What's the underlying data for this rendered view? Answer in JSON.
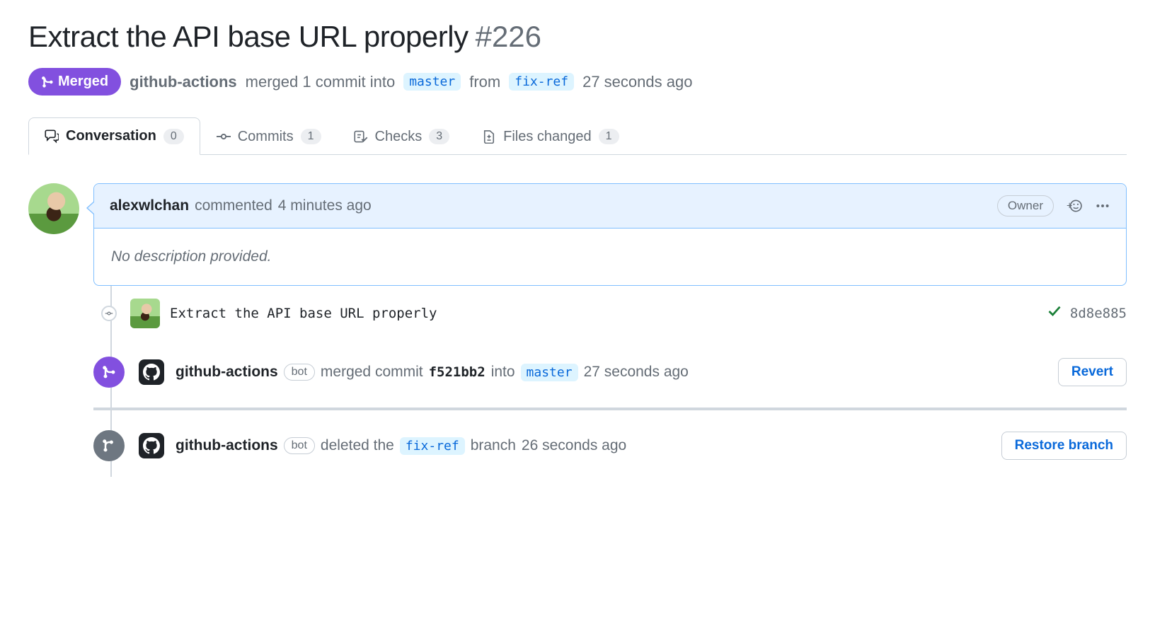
{
  "pr": {
    "title": "Extract the API base URL properly",
    "number": "#226",
    "state": "Merged",
    "meta_actor": "github-actions",
    "meta_text1": "merged 1 commit into",
    "base_branch": "master",
    "meta_text2": "from",
    "head_branch": "fix-ref",
    "meta_time": "27 seconds ago"
  },
  "tabs": {
    "conversation": {
      "label": "Conversation",
      "count": "0"
    },
    "commits": {
      "label": "Commits",
      "count": "1"
    },
    "checks": {
      "label": "Checks",
      "count": "3"
    },
    "files": {
      "label": "Files changed",
      "count": "1"
    }
  },
  "comment": {
    "author": "alexwlchan",
    "action": "commented",
    "time": "4 minutes ago",
    "role": "Owner",
    "body": "No description provided."
  },
  "commit_event": {
    "message": "Extract the API base URL properly",
    "sha": "8d8e885"
  },
  "merge_event": {
    "actor": "github-actions",
    "bot": "bot",
    "text1": "merged commit",
    "commit": "f521bb2",
    "text2": "into",
    "branch": "master",
    "time": "27 seconds ago",
    "button": "Revert"
  },
  "delete_event": {
    "actor": "github-actions",
    "bot": "bot",
    "text1": "deleted the",
    "branch": "fix-ref",
    "text2": "branch",
    "time": "26 seconds ago",
    "button": "Restore branch"
  }
}
